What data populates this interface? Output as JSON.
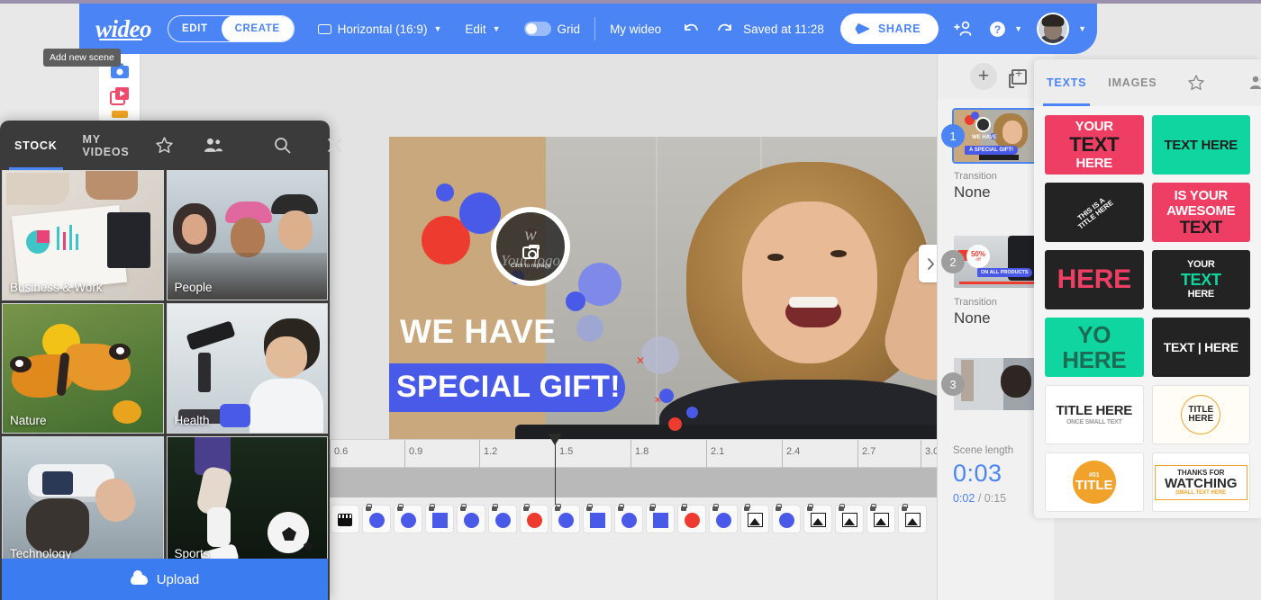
{
  "header": {
    "logo": "wideo",
    "segments": [
      {
        "label": "EDIT",
        "active": false
      },
      {
        "label": "CREATE",
        "active": true
      }
    ],
    "format": "Horizontal (16:9)",
    "edit_menu": "Edit",
    "grid_label": "Grid",
    "project_title": "My wideo",
    "saved_status": "Saved at 11:28",
    "share_label": "SHARE",
    "undo_icon": "undo-icon",
    "redo_icon": "redo-icon",
    "add_user_icon": "add-person-icon",
    "help_icon": "help-icon",
    "accent_color": "#4a84f5"
  },
  "left_rail": {
    "items": [
      {
        "icon": "camera-icon",
        "color": "#4a84f5"
      },
      {
        "icon": "video-icon",
        "color": "#ef4a6b"
      },
      {
        "icon": "shapes-icon",
        "color": "#f5a623"
      }
    ]
  },
  "canvas": {
    "logo_placeholder": "Your logo",
    "logo_hint": "Click to replace",
    "logo_watermark": "w",
    "headline": "WE HAVE",
    "subheadline": "SPECIAL GIFT!",
    "band_color": "#4a5ae8",
    "collapse_icon": "chevron-right-icon"
  },
  "timeline": {
    "ticks": [
      "0.6",
      "0.9",
      "1.2",
      "1.5",
      "1.8",
      "2.1",
      "2.4",
      "2.7",
      "3.0"
    ],
    "playhead_at": "1.5",
    "layers": [
      {
        "type": "film",
        "color": "#111111"
      },
      {
        "type": "circle",
        "color": "#4a5ae8"
      },
      {
        "type": "circle",
        "color": "#4a5ae8"
      },
      {
        "type": "square",
        "color": "#4a5ae8"
      },
      {
        "type": "circle",
        "color": "#4a5ae8"
      },
      {
        "type": "circle",
        "color": "#4a5ae8"
      },
      {
        "type": "circle",
        "color": "#ee3b30"
      },
      {
        "type": "circle",
        "color": "#4a5ae8"
      },
      {
        "type": "square",
        "color": "#4a5ae8"
      },
      {
        "type": "circle",
        "color": "#4a5ae8"
      },
      {
        "type": "square",
        "color": "#4a5ae8"
      },
      {
        "type": "circle",
        "color": "#ee3b30"
      },
      {
        "type": "circle",
        "color": "#4a5ae8"
      },
      {
        "type": "image",
        "color": "#1a1a1a"
      },
      {
        "type": "circle",
        "color": "#4a5ae8"
      },
      {
        "type": "image",
        "color": "#1a1a1a"
      },
      {
        "type": "image",
        "color": "#1a1a1a"
      },
      {
        "type": "image",
        "color": "#1a1a1a"
      },
      {
        "type": "image",
        "color": "#1a1a1a"
      }
    ]
  },
  "scenes": {
    "add_scene_icon": "plus-icon",
    "duplicate_scene_icon": "duplicate-scene-icon",
    "tooltip": "Add new scene",
    "items": [
      {
        "number": "1",
        "selected": true,
        "transition_label": "Transition",
        "transition_value": "None",
        "caption_top": "WE HAVE",
        "caption_bottom": "A SPECIAL GIFT!"
      },
      {
        "number": "2",
        "selected": false,
        "transition_label": "Transition",
        "transition_value": "None",
        "badge": "50%",
        "badge_sub": "off",
        "caption_bottom": "ON ALL PRODUCTS"
      },
      {
        "number": "3",
        "selected": false,
        "transition_label": "",
        "transition_value": ""
      }
    ],
    "scene_length_label": "Scene length",
    "scene_length_value": "0:03",
    "current_time": "0:02",
    "total_time": "0:15"
  },
  "text_library": {
    "tabs": [
      {
        "label": "TEXTS",
        "active": true
      },
      {
        "label": "IMAGES",
        "active": false
      }
    ],
    "favorites_icon": "star-icon",
    "shared_icon": "people-icon",
    "cards": [
      {
        "id": "t1",
        "bg": "#ef3e63",
        "lines": [
          {
            "t": "YOUR",
            "c": "#ffffff",
            "s": 15
          },
          {
            "t": "TEXT",
            "c": "#1c1c1c",
            "s": 22
          },
          {
            "t": "HERE",
            "c": "#ffffff",
            "s": 15
          }
        ]
      },
      {
        "id": "t2",
        "bg": "#0fd6a0",
        "lines": [
          {
            "t": "TEXT HERE",
            "c": "#1c1c1c",
            "s": 15
          }
        ]
      },
      {
        "id": "t3",
        "bg": "#232323",
        "lines": [
          {
            "t": "THIS IS A",
            "c": "#ffffff",
            "s": 8
          },
          {
            "t": "TITLE HERE",
            "c": "#ffffff",
            "s": 8
          }
        ]
      },
      {
        "id": "t4",
        "bg": "#ef3e63",
        "lines": [
          {
            "t": "IS YOUR",
            "c": "#ffffff",
            "s": 15
          },
          {
            "t": "AWESOME",
            "c": "#ffffff",
            "s": 15
          },
          {
            "t": "TEXT",
            "c": "#1c1c1c",
            "s": 19
          }
        ]
      },
      {
        "id": "t5",
        "bg": "#232323",
        "lines": [
          {
            "t": "HERE",
            "c": "#ef3e63",
            "s": 30
          }
        ]
      },
      {
        "id": "t6",
        "bg": "#232323",
        "lines": [
          {
            "t": "YOUR",
            "c": "#ffffff",
            "s": 11
          },
          {
            "t": "TEXT",
            "c": "#0fd6a0",
            "s": 18
          },
          {
            "t": "HERE",
            "c": "#ffffff",
            "s": 11
          }
        ]
      },
      {
        "id": "t7",
        "bg": "#0fd6a0",
        "lines": [
          {
            "t": "YO",
            "c": "#1c6b52",
            "s": 26
          },
          {
            "t": "HERE",
            "c": "#1c6b52",
            "s": 26
          }
        ]
      },
      {
        "id": "t8",
        "bg": "#232323",
        "lines": [
          {
            "t": "TEXT | HERE",
            "c": "#ffffff",
            "s": 14
          }
        ]
      },
      {
        "id": "t9",
        "bg": "#ffffff",
        "lines": [
          {
            "t": "TITLE HERE",
            "c": "#2b2b2b",
            "s": 15
          },
          {
            "t": "ONCE SMALL TEXT",
            "c": "#9a9a9a",
            "s": 7
          }
        ]
      },
      {
        "id": "t10",
        "bg": "#fffdf6",
        "lines": [
          {
            "t": "TITLE",
            "c": "#2b2b2b",
            "s": 10
          },
          {
            "t": "HERE",
            "c": "#2b2b2b",
            "s": 10
          }
        ]
      },
      {
        "id": "t11",
        "bg": "#ffffff",
        "lines": [
          {
            "t": "#01",
            "c": "#ffffff",
            "s": 7
          },
          {
            "t": "TITLE",
            "c": "#ffffff",
            "s": 15
          }
        ]
      },
      {
        "id": "t12",
        "bg": "#ffffff",
        "lines": [
          {
            "t": "THANKS FOR",
            "c": "#2b2b2b",
            "s": 8
          },
          {
            "t": "WATCHING",
            "c": "#2b2b2b",
            "s": 15
          },
          {
            "t": "SMALL TEXT HERE",
            "c": "#f0a22a",
            "s": 6
          }
        ]
      }
    ]
  },
  "media_panel": {
    "tabs": [
      {
        "label": "STOCK",
        "active": true
      },
      {
        "label": "MY VIDEOS",
        "active": false
      }
    ],
    "favorites_icon": "star-icon",
    "shared_icon": "people-icon",
    "search_icon": "search-icon",
    "close_icon": "close-icon",
    "categories": [
      {
        "label": "Business & Work"
      },
      {
        "label": "People"
      },
      {
        "label": "Nature"
      },
      {
        "label": "Health"
      },
      {
        "label": "Technology"
      },
      {
        "label": "Sports"
      }
    ],
    "upload_label": "Upload",
    "upload_icon": "cloud-upload-icon"
  }
}
